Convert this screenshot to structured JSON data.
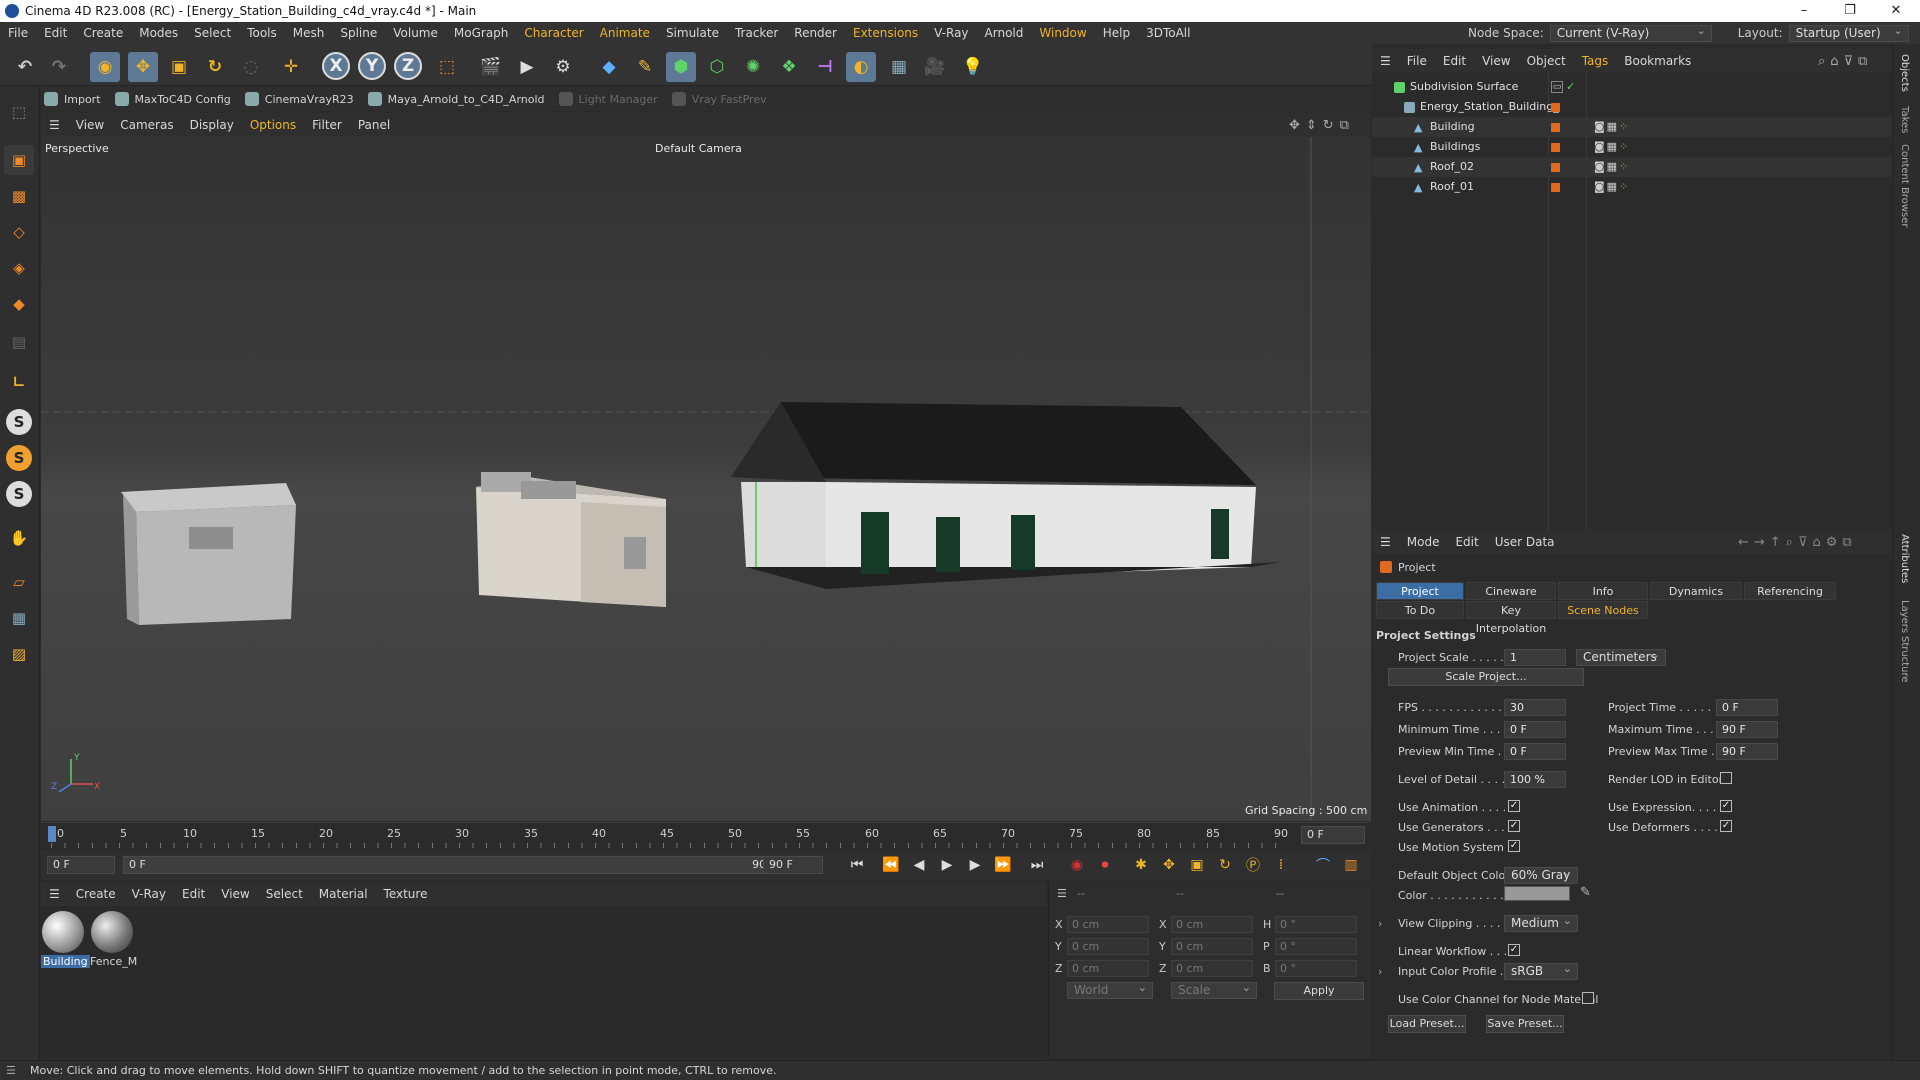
{
  "window": {
    "title": "Cinema 4D R23.008 (RC) - [Energy_Station_Building_c4d_vray.c4d *] - Main",
    "minimize": "–",
    "maximize": "❐",
    "close": "✕"
  },
  "menubar": {
    "items": [
      "File",
      "Edit",
      "Create",
      "Modes",
      "Select",
      "Tools",
      "Mesh",
      "Spline",
      "Volume",
      "MoGraph",
      "Character",
      "Animate",
      "Simulate",
      "Tracker",
      "Render",
      "Extensions",
      "V-Ray",
      "Arnold",
      "Window",
      "Help",
      "3DToAll"
    ],
    "node_space_label": "Node Space:",
    "node_space_value": "Current (V-Ray)",
    "layout_label": "Layout:",
    "layout_value": "Startup (User)"
  },
  "toolbar": {
    "axis_x": "X",
    "axis_y": "Y",
    "axis_z": "Z"
  },
  "toolbar2": {
    "items": [
      "Import",
      "MaxToC4D Config",
      "CinemaVrayR23",
      "Maya_Arnold_to_C4D_Arnold",
      "Light Manager",
      "Vray FastPrev"
    ]
  },
  "viewport": {
    "menu": [
      "View",
      "Cameras",
      "Display",
      "Options",
      "Filter",
      "Panel"
    ],
    "label": "Perspective",
    "camera": "Default Camera",
    "grid_spacing": "Grid Spacing : 500 cm",
    "axis_y": "Y",
    "axis_x": "X",
    "axis_z": "Z"
  },
  "timeline": {
    "ticks": [
      "0",
      "5",
      "10",
      "15",
      "20",
      "25",
      "30",
      "35",
      "40",
      "45",
      "50",
      "55",
      "60",
      "65",
      "70",
      "75",
      "80",
      "85",
      "90"
    ],
    "current_frame": "0 F"
  },
  "transport": {
    "start": "0 F",
    "range_start": "0 F",
    "range_end": "90 F",
    "end": "90 F"
  },
  "materials": {
    "menu": [
      "Create",
      "V-Ray",
      "Edit",
      "View",
      "Select",
      "Material",
      "Texture"
    ],
    "items": [
      {
        "name": "Building"
      },
      {
        "name": "Fence_M"
      }
    ]
  },
  "coords": {
    "headers": [
      "--",
      "--",
      "--"
    ],
    "rows": [
      {
        "a": "X",
        "av": "0 cm",
        "b": "X",
        "bv": "0 cm",
        "c": "H",
        "cv": "0 °"
      },
      {
        "a": "Y",
        "av": "0 cm",
        "b": "Y",
        "bv": "0 cm",
        "c": "P",
        "cv": "0 °"
      },
      {
        "a": "Z",
        "av": "0 cm",
        "b": "Z",
        "bv": "0 cm",
        "c": "B",
        "cv": "0 °"
      }
    ],
    "mode1": "World",
    "mode2": "Scale",
    "apply": "Apply"
  },
  "status": "Move: Click and drag to move elements. Hold down SHIFT to quantize movement / add to the selection in point mode, CTRL to remove.",
  "objects": {
    "menu": [
      "File",
      "Edit",
      "View",
      "Object",
      "Tags",
      "Bookmarks"
    ],
    "items": [
      {
        "name": "Subdivision Surface"
      },
      {
        "name": "Energy_Station_Building_"
      },
      {
        "name": "Building"
      },
      {
        "name": "Buildings"
      },
      {
        "name": "Roof_02"
      },
      {
        "name": "Roof_01"
      }
    ]
  },
  "attributes": {
    "menu": [
      "Mode",
      "Edit",
      "User Data"
    ],
    "header": "Project",
    "tabs1": [
      "Project Settings",
      "Cineware",
      "Info",
      "Dynamics",
      "Referencing"
    ],
    "tabs2": [
      "To Do",
      "Key Interpolation",
      "Scene Nodes"
    ],
    "section": "Project Settings",
    "project_scale_label": "Project Scale . . . . .",
    "project_scale_value": "1",
    "project_scale_unit": "Centimeters",
    "scale_project_btn": "Scale Project...",
    "fps_label": "FPS . . . . . . . . . . . . .",
    "fps_value": "30",
    "project_time_label": "Project Time . . . . .",
    "project_time_value": "0 F",
    "min_time_label": "Minimum Time . . . .",
    "min_time_value": "0 F",
    "max_time_label": "Maximum Time . . . .",
    "max_time_value": "90 F",
    "prev_min_label": "Preview Min Time . .",
    "prev_min_value": "0 F",
    "prev_max_label": "Preview Max Time . .",
    "prev_max_value": "90 F",
    "lod_label": "Level of Detail . . . .",
    "lod_value": "100 %",
    "render_lod_label": "Render LOD in Editor",
    "use_anim_label": "Use Animation . . . .",
    "use_expr_label": "Use Expression. . . .",
    "use_gen_label": "Use Generators . . .",
    "use_def_label": "Use Deformers . . . .",
    "use_motion_label": "Use Motion System",
    "def_color_label": "Default Object Color",
    "def_color_value": "60% Gray",
    "color_label": "Color . . . . . . . . . . .",
    "view_clip_label": "View Clipping . . . . .",
    "view_clip_value": "Medium",
    "linear_label": "Linear Workflow . . .",
    "input_profile_label": "Input Color Profile . .",
    "input_profile_value": "sRGB",
    "node_mat_label": "Use Color Channel for Node Material",
    "load_preset": "Load Preset...",
    "save_preset": "Save Preset..."
  },
  "side_tabs": [
    "Objects",
    "Takes",
    "Content Browser",
    "Attributes",
    "Layers",
    "Structure"
  ],
  "colors": {
    "accent": "#3b6ea5",
    "highlight": "#f0b429",
    "tag_orange": "#e06b1f"
  }
}
